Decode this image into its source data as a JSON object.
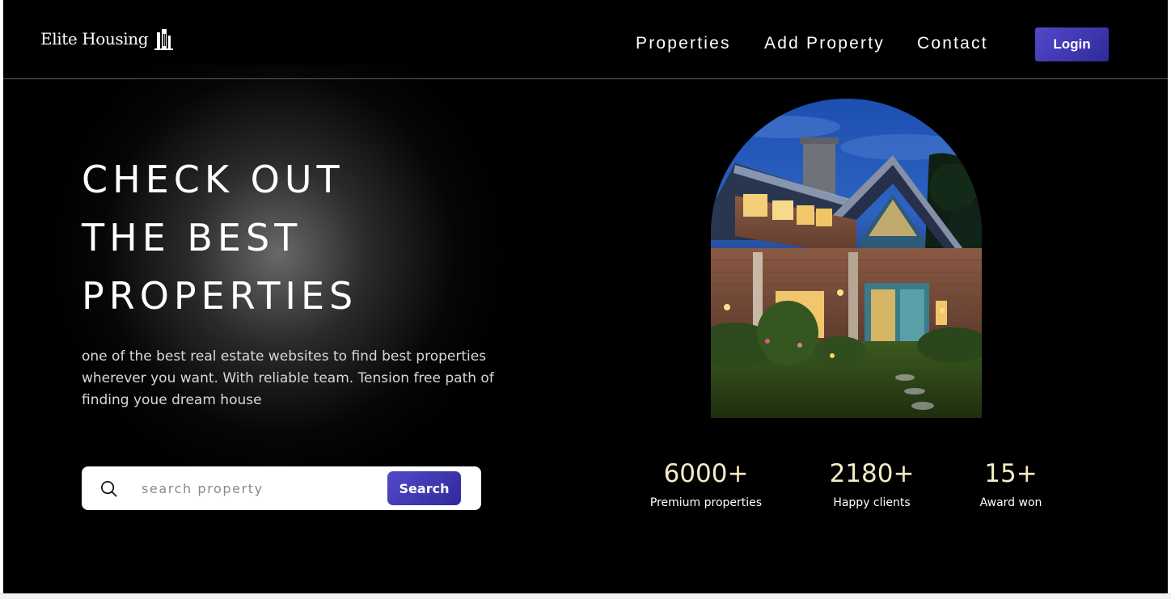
{
  "header": {
    "logo_text": "Elite Housing",
    "logo_icon": "building-icon",
    "nav": [
      "Properties",
      "Add Property",
      "Contact"
    ],
    "login_label": "Login"
  },
  "hero": {
    "title_lines": [
      "CHECK OUT",
      "THE BEST",
      "PROPERTIES"
    ],
    "description": "one of the best real estate websites to find best properties wherever you want. With reliable team. Tension free path of finding youe dream house",
    "search": {
      "placeholder": "search property",
      "button_label": "Search",
      "icon": "search-icon"
    }
  },
  "stats": [
    {
      "value": "6000+",
      "label": "Premium properties"
    },
    {
      "value": "2180+",
      "label": "Happy clients"
    },
    {
      "value": "15+",
      "label": "Award won"
    }
  ],
  "colors": {
    "background": "#000000",
    "accent": "#4a43c2",
    "stat_value": "#f4ecc4"
  }
}
